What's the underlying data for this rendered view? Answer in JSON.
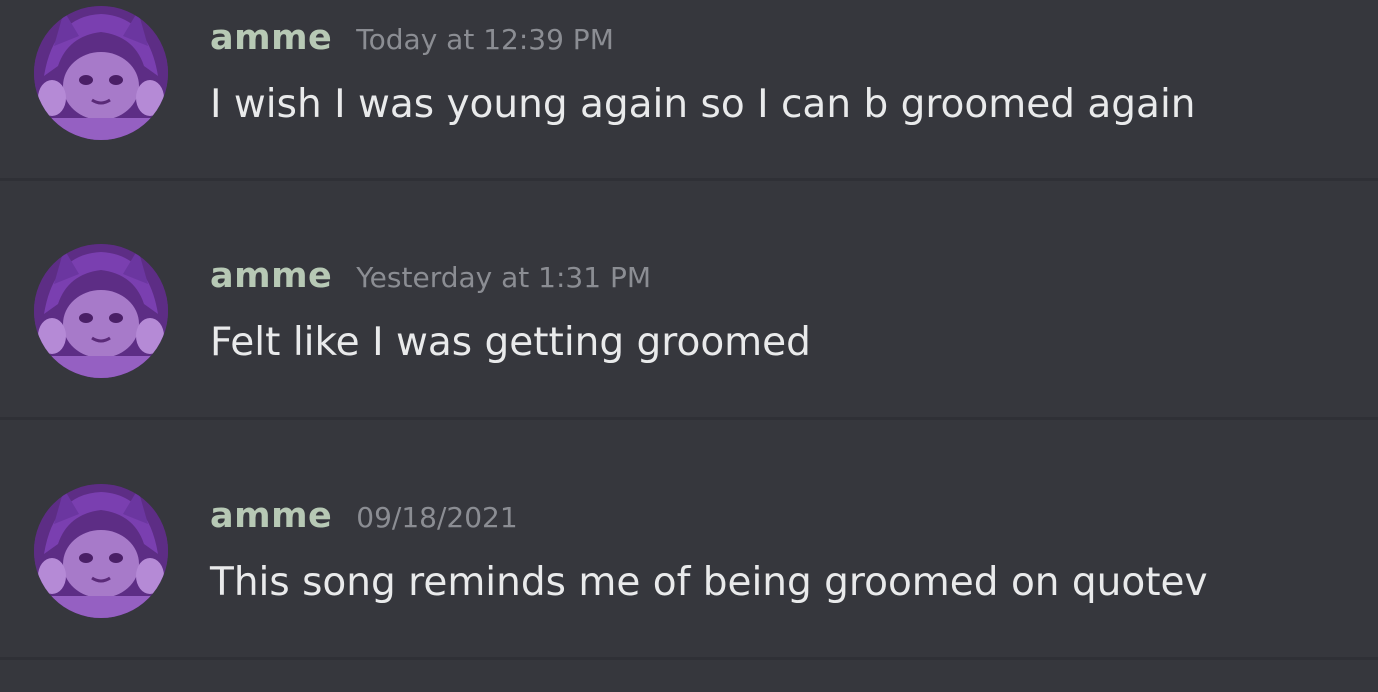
{
  "messages": [
    {
      "username": "amme",
      "timestamp": "Today at 12:39 PM",
      "text": "I wish I was young again so I can b groomed again"
    },
    {
      "username": "amme",
      "timestamp": "Yesterday at 1:31 PM",
      "text": "Felt like I was getting groomed"
    },
    {
      "username": "amme",
      "timestamp": "09/18/2021",
      "text": "This song reminds me of being groomed on quotev"
    }
  ],
  "colors": {
    "background": "#36373d",
    "username": "#b7c9b5",
    "timestamp": "#8b8d93",
    "text": "#e9eaeb",
    "avatar_accent": "#8d54c2"
  },
  "icons": {
    "avatar": "anime-character-avatar"
  }
}
